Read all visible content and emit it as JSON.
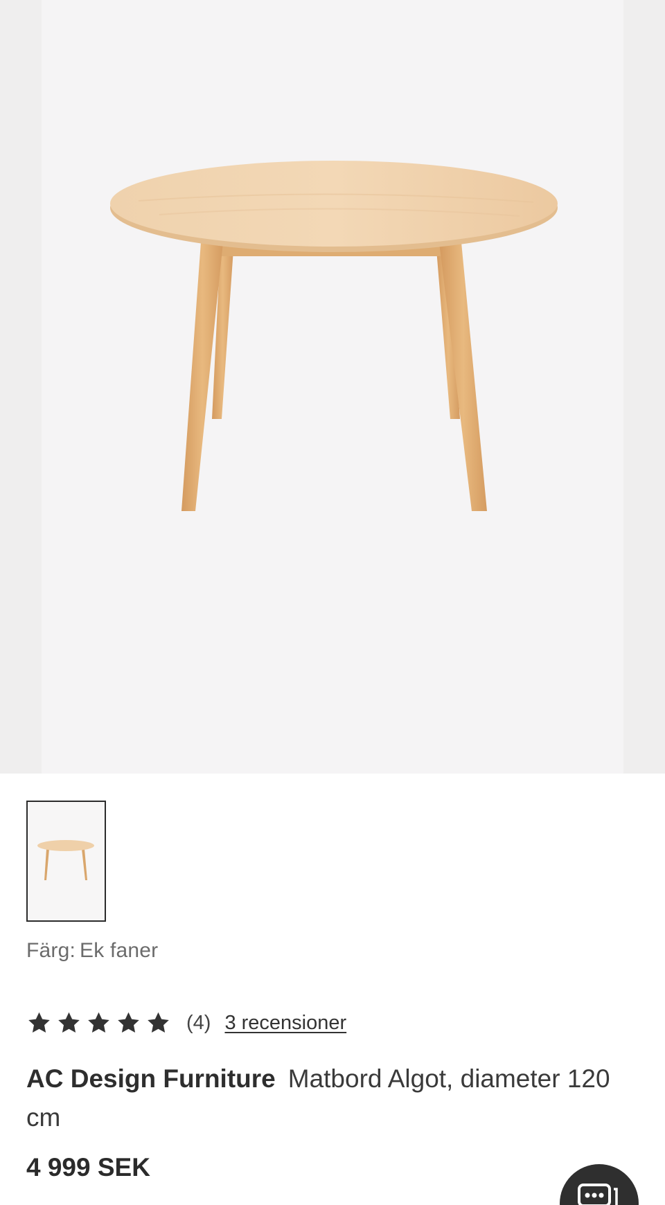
{
  "product": {
    "color_label": "Färg:",
    "color_value": "Ek faner",
    "rating_count": "(4)",
    "reviews_link": "3 recensioner",
    "rating_value": 5,
    "brand": "AC Design Furniture",
    "name": "Matbord Algot, diameter 120 cm",
    "price": "4 999 SEK"
  },
  "icons": {
    "star": "star-icon",
    "chat": "chat-icon"
  },
  "colors": {
    "wood": "#e9c9a0",
    "star": "#333333",
    "chat_bg": "#2f2f2f"
  }
}
